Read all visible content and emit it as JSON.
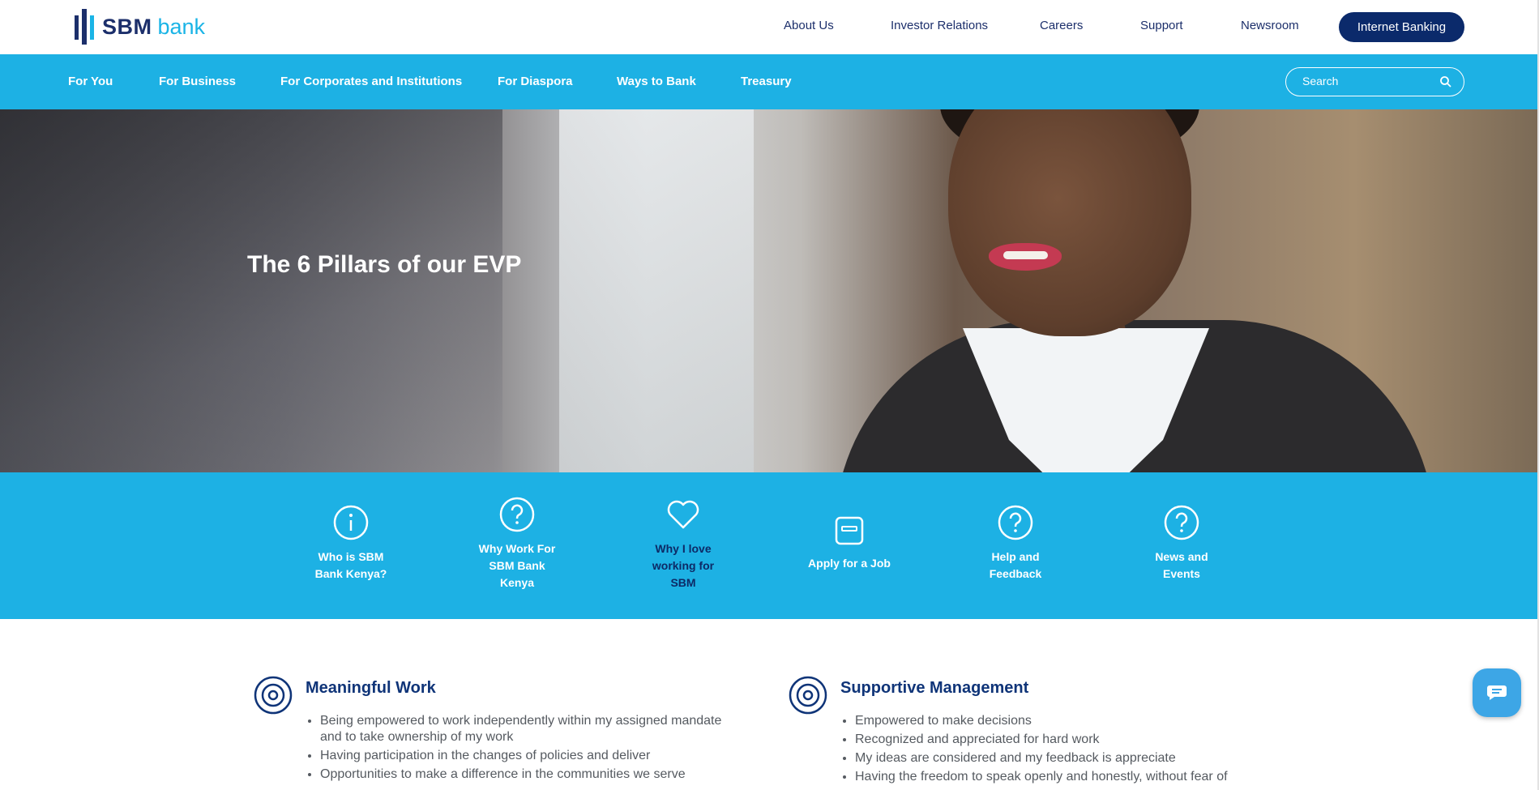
{
  "brand": {
    "name_bold": "SBM",
    "name_light": "bank"
  },
  "top_links": [
    "About Us",
    "Investor Relations",
    "Careers",
    "Support",
    "Newsroom"
  ],
  "internet_banking": "Internet Banking",
  "nav": [
    "For You",
    "For Business",
    "For Corporates and Institutions",
    "For Diaspora",
    "Ways to Bank",
    "Treasury"
  ],
  "search": {
    "placeholder": "Search"
  },
  "hero": {
    "title": "The 6 Pillars of our EVP"
  },
  "quick_links": [
    {
      "label_lines": [
        "Who is SBM",
        "Bank Kenya?"
      ],
      "icon": "info-icon"
    },
    {
      "label_lines": [
        "Why Work For",
        "SBM Bank",
        "Kenya"
      ],
      "icon": "question-icon"
    },
    {
      "label_lines": [
        "Why I love",
        "working for",
        "SBM"
      ],
      "icon": "heart-icon"
    },
    {
      "label_lines": [
        "Apply for a Job"
      ],
      "icon": "apply-icon"
    },
    {
      "label_lines": [
        "Help and",
        "Feedback"
      ],
      "icon": "question-icon"
    },
    {
      "label_lines": [
        "News and",
        "Events"
      ],
      "icon": "question-icon"
    }
  ],
  "pillars": [
    {
      "title": "Meaningful Work",
      "items": [
        "Being empowered to work independently within my assigned mandate and to take ownership of my work",
        "Having participation in the changes of policies and deliver",
        "Opportunities to make a difference in the communities we serve"
      ]
    },
    {
      "title": "Supportive Management",
      "items": [
        "Empowered to make decisions",
        "Recognized and appreciated for hard work",
        "My ideas are considered and my feedback is appreciate",
        "Having the freedom to speak openly and honestly, without fear of"
      ]
    }
  ],
  "colors": {
    "primary_blue": "#1db1e4",
    "navy": "#0b2a6b"
  }
}
